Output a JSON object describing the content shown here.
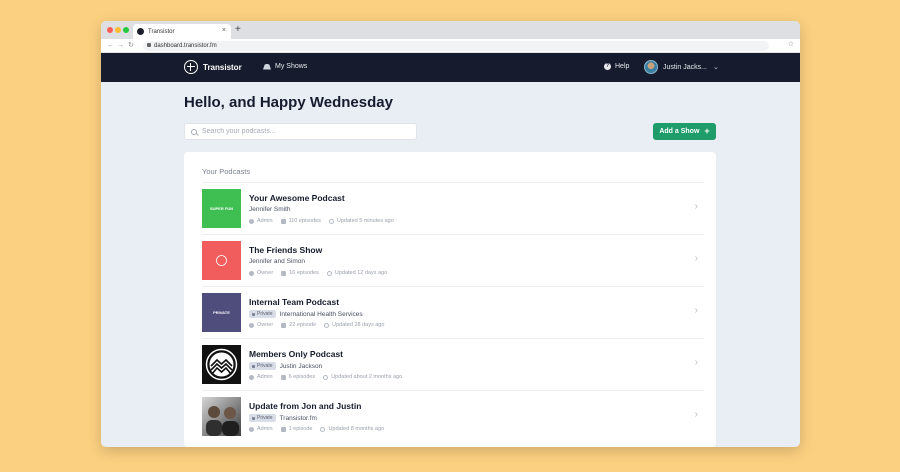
{
  "browser": {
    "tab_title": "Transistor",
    "tab_close": "×",
    "new_tab": "+",
    "url": "dashboard.transistor.fm",
    "back": "←",
    "forward": "→",
    "reload": "↻",
    "star": "☆"
  },
  "appbar": {
    "brand": "Transistor",
    "my_shows": "My Shows",
    "help": "Help",
    "help_glyph": "?",
    "user_name": "Justin Jacks...",
    "chevron": "⌄"
  },
  "main": {
    "greeting": "Hello, and Happy Wednesday",
    "search_placeholder": "Search your podcasts...",
    "add_show": "Add a Show",
    "add_show_icon": "+",
    "section_title": "Your Podcasts"
  },
  "podcasts": [
    {
      "title": "Your Awesome Podcast",
      "author": "Jennifer Smith",
      "private": false,
      "role": "Admin",
      "episodes": "110 episodes",
      "updated": "Updated 5 minutes ago",
      "art_label": "SUPER FUN",
      "art_color": "#3fbf52"
    },
    {
      "title": "The Friends Show",
      "author": "Jennifer and Simon",
      "private": false,
      "role": "Owner",
      "episodes": "16 episodes",
      "updated": "Updated 12 days ago",
      "art_label": "",
      "art_color": "#f15c5c"
    },
    {
      "title": "Internal Team Podcast",
      "author": "International Health Services",
      "private": true,
      "private_label": "Private",
      "role": "Owner",
      "episodes": "22 episode",
      "updated": "Updated 28 days ago",
      "art_label": "PRIVATE",
      "art_color": "#4f4d7c"
    },
    {
      "title": "Members Only Podcast",
      "author": "Justin Jackson",
      "private": true,
      "private_label": "Private",
      "role": "Admin",
      "episodes": "6 episodes",
      "updated": "Updated about 2 months ago",
      "art_label": "",
      "art_color": "#111111"
    },
    {
      "title": "Update from Jon and Justin",
      "author": "Transistor.fm",
      "private": true,
      "private_label": "Private",
      "role": "Admin",
      "episodes": "1 episode",
      "updated": "Updated 8 months ago",
      "art_label": "",
      "art_color": "#8a8a8a"
    }
  ],
  "row_arrow": "›",
  "colors": {
    "background": "#fbd080",
    "appbar": "#161c2d",
    "accent_green": "#1e9c6a",
    "page_bg": "#e9eef5"
  }
}
